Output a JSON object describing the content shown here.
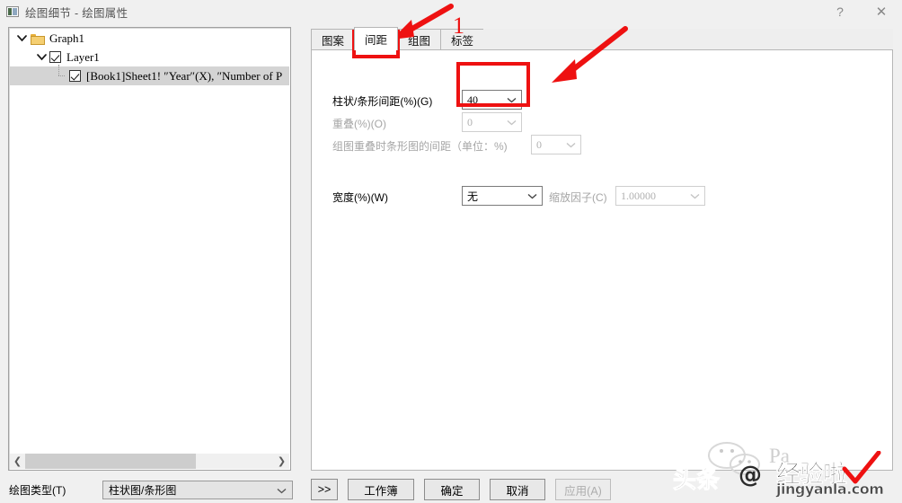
{
  "window": {
    "title": "绘图细节 - 绘图属性",
    "icon": "plot-details-icon",
    "help_label": "?",
    "close_label": "✕"
  },
  "tree": {
    "nodes": [
      {
        "label": "Graph1",
        "type": "folder",
        "expanded": true,
        "level": 0,
        "selected": false
      },
      {
        "label": "Layer1",
        "type": "checkbox",
        "expanded": true,
        "level": 1,
        "selected": false,
        "checked": true
      },
      {
        "label": "[Book1]Sheet1! ″Year″(X), ″Number of P",
        "type": "checkbox",
        "level": 2,
        "selected": true,
        "checked": true
      }
    ],
    "scrollbar": {
      "left_arrow": "❮",
      "right_arrow": "❯"
    }
  },
  "plot_type": {
    "label": "绘图类型(T)",
    "value": "柱状图/条形图",
    "arrow": "⌄"
  },
  "tabs": [
    {
      "label": "图案",
      "active": false
    },
    {
      "label": "间距",
      "active": true
    },
    {
      "label": "组图",
      "active": false
    },
    {
      "label": "标签",
      "active": false
    }
  ],
  "spacing_page": {
    "gap_row": {
      "label": "柱状/条形间距(%)(G)",
      "value": "40",
      "arrow": "⌄",
      "disabled": false
    },
    "overlap_row": {
      "label": "重叠(%)(O)",
      "value": "0",
      "arrow": "⌄",
      "disabled": true
    },
    "group_overlap_row": {
      "label": "组图重叠时条形图的间距（单位：%)",
      "value": "0",
      "arrow": "⌄",
      "disabled": true
    },
    "width_row": {
      "label": "宽度(%)(W)",
      "value": "无",
      "arrow": "⌄",
      "disabled": false
    },
    "scale_row": {
      "label": "缩放因子(C)",
      "value": "1.00000",
      "arrow": "⌄",
      "disabled": true
    }
  },
  "buttons": {
    "more": ">>",
    "workbook": "工作簿",
    "ok": "确定",
    "cancel": "取消",
    "apply": "应用(A)"
  },
  "annotations": {
    "step_number": "1",
    "color": "#ee1111",
    "boxes": [
      "tab-spacing-highlight",
      "gap-and-overlap-highlight"
    ],
    "arrows": [
      "arrow-to-tab",
      "arrow-to-value"
    ]
  },
  "watermark": {
    "toutiao": "头条",
    "at": "@",
    "pa": "Pa",
    "chinese": "经验啦",
    "domain": "jingyanla.com"
  }
}
